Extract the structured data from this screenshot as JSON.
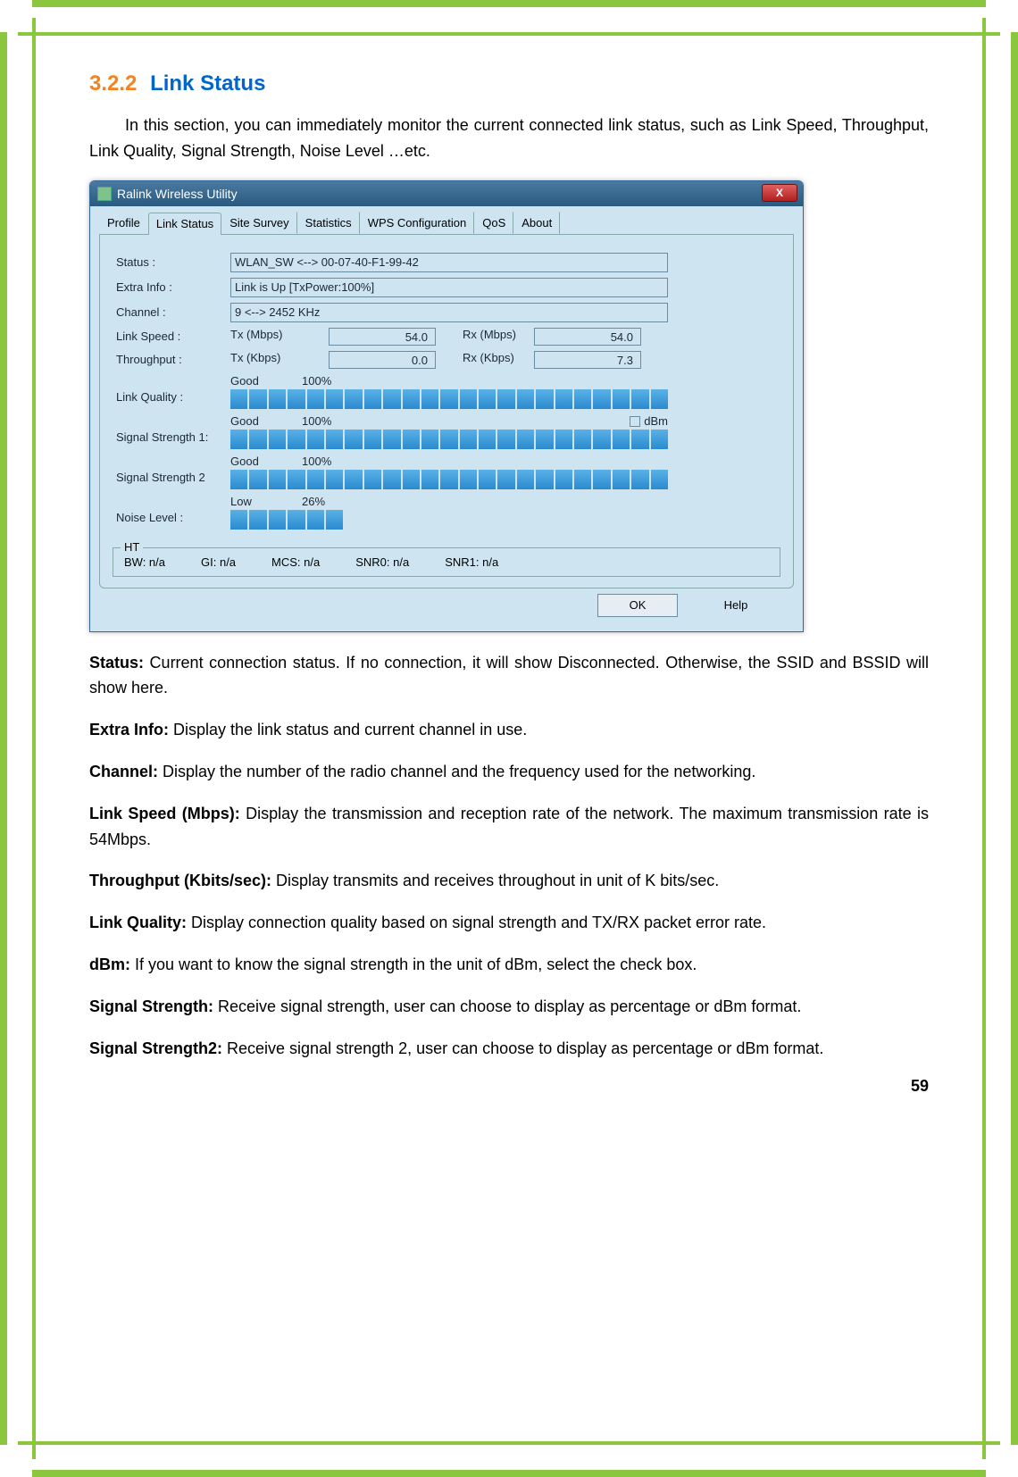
{
  "heading": {
    "number": "3.2.2",
    "title": "Link Status"
  },
  "intro": "In this section, you can immediately monitor the current connected link status, such as Link Speed, Throughput, Link Quality, Signal Strength, Noise Level …etc.",
  "dialog": {
    "title": "Ralink Wireless Utility",
    "close": "X",
    "tabs": [
      "Profile",
      "Link Status",
      "Site Survey",
      "Statistics",
      "WPS Configuration",
      "QoS",
      "About"
    ],
    "active_tab": "Link Status",
    "fields": {
      "status_label": "Status :",
      "status_value": "WLAN_SW <--> 00-07-40-F1-99-42",
      "extra_label": "Extra Info :",
      "extra_value": "Link is Up [TxPower:100%]",
      "channel_label": "Channel :",
      "channel_value": "9 <--> 2452 KHz",
      "linkspeed_label": "Link Speed :",
      "tx_mbps_label": "Tx (Mbps)",
      "tx_mbps_value": "54.0",
      "rx_mbps_label": "Rx (Mbps)",
      "rx_mbps_value": "54.0",
      "throughput_label": "Throughput :",
      "tx_kbps_label": "Tx (Kbps)",
      "tx_kbps_value": "0.0",
      "rx_kbps_label": "Rx (Kbps)",
      "rx_kbps_value": "7.3",
      "linkquality_label": "Link Quality :",
      "lq_quality": "Good",
      "lq_pct": "100%",
      "sig1_label": "Signal Strength 1:",
      "sig1_quality": "Good",
      "sig1_pct": "100%",
      "dbm_label": "dBm",
      "sig2_label": "Signal Strength 2",
      "sig2_quality": "Good",
      "sig2_pct": "100%",
      "noise_label": "Noise Level :",
      "noise_quality": "Low",
      "noise_pct": "26%"
    },
    "ht": {
      "legend": "HT",
      "bw": "BW: n/a",
      "gi": "GI: n/a",
      "mcs": "MCS: n/a",
      "snr0": "SNR0: n/a",
      "snr1": "SNR1: n/a"
    },
    "buttons": {
      "ok": "OK",
      "help": "Help"
    }
  },
  "defs": [
    {
      "term": "Status:",
      "text": " Current connection status. If no connection, it will show Disconnected. Otherwise, the SSID and BSSID will show here."
    },
    {
      "term": "Extra Info:",
      "text": " Display the link status and current channel in use."
    },
    {
      "term": "Channel:",
      "text": " Display the number of the radio channel and the frequency used for the networking."
    },
    {
      "term": "Link Speed (Mbps):",
      "text": " Display the transmission and reception rate of the network. The maximum transmission rate is 54Mbps."
    },
    {
      "term": "Throughput (Kbits/sec):",
      "text": " Display transmits and receives throughout in unit of K bits/sec."
    },
    {
      "term": "Link Quality:",
      "text": " Display connection quality based on signal strength and TX/RX packet error rate."
    },
    {
      "term": "dBm:",
      "text": " If you want to know the signal strength in the unit of dBm, select the check box."
    },
    {
      "term": "Signal Strength:",
      "text": " Receive signal strength, user can choose to display as percentage or dBm format."
    },
    {
      "term": "Signal Strength2:",
      "text": " Receive signal strength 2, user can choose to display as percentage or dBm format."
    }
  ],
  "pagenum": "59"
}
